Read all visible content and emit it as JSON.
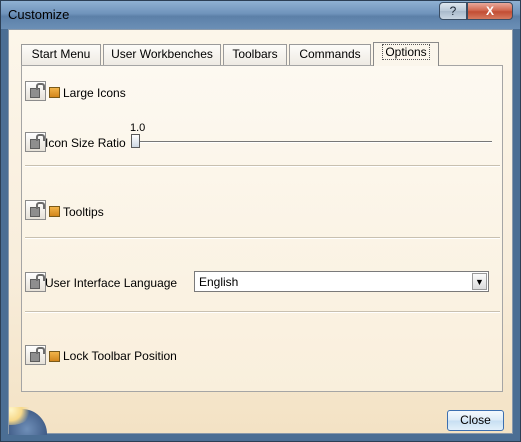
{
  "window": {
    "title": "Customize",
    "help_label": "?",
    "close_label": "X"
  },
  "tabs": [
    {
      "label": "Start Menu"
    },
    {
      "label": "User Workbenches"
    },
    {
      "label": "Toolbars"
    },
    {
      "label": "Commands"
    },
    {
      "label": "Options"
    }
  ],
  "active_tab": "Options",
  "options": {
    "large_icons": {
      "label": "Large Icons",
      "checked": true
    },
    "icon_size_ratio": {
      "label": "Icon Size Ratio",
      "value": "1.0",
      "min_fraction": 0.0
    },
    "tooltips": {
      "label": "Tooltips",
      "checked": true
    },
    "ui_language": {
      "label": "User Interface Language",
      "selected": "English"
    },
    "lock_toolbar": {
      "label": "Lock Toolbar Position",
      "checked": true
    }
  },
  "footer": {
    "close_button": "Close"
  },
  "colors": {
    "accent_check": "#d2861c",
    "panel_bg": "#fbf6ec",
    "title_bar": "#6f93bb"
  }
}
